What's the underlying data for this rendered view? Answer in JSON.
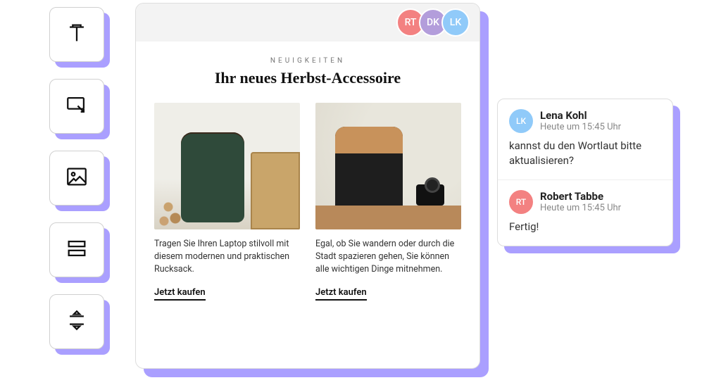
{
  "toolbar": {
    "items": [
      {
        "name": "text-tool"
      },
      {
        "name": "button-tool"
      },
      {
        "name": "image-tool"
      },
      {
        "name": "layout-tool"
      },
      {
        "name": "spacer-tool"
      }
    ]
  },
  "collaborators": [
    {
      "initials": "RT",
      "style": "rt"
    },
    {
      "initials": "DK",
      "style": "dk"
    },
    {
      "initials": "LK",
      "style": "lk"
    }
  ],
  "content": {
    "eyebrow": "NEUIGKEITEN",
    "headline": "Ihr neues Herbst-Accessoire",
    "products": [
      {
        "desc": "Tragen Sie Ihren Laptop stilvoll mit diesem modernen und praktischen Rucksack.",
        "cta": "Jetzt kaufen"
      },
      {
        "desc": "Egal, ob Sie wandern oder durch die Stadt spazieren gehen, Sie können alle wichtigen Dinge mitnehmen.",
        "cta": "Jetzt kaufen"
      }
    ]
  },
  "comments": [
    {
      "initials": "LK",
      "avatarStyle": "lk",
      "name": "Lena Kohl",
      "time": "Heute um 15:45 Uhr",
      "body": "kannst du den Wortlaut bitte aktualisieren?"
    },
    {
      "initials": "RT",
      "avatarStyle": "rt",
      "name": "Robert Tabbe",
      "time": "Heute um 15:45 Uhr",
      "body": "Fertig!"
    }
  ]
}
